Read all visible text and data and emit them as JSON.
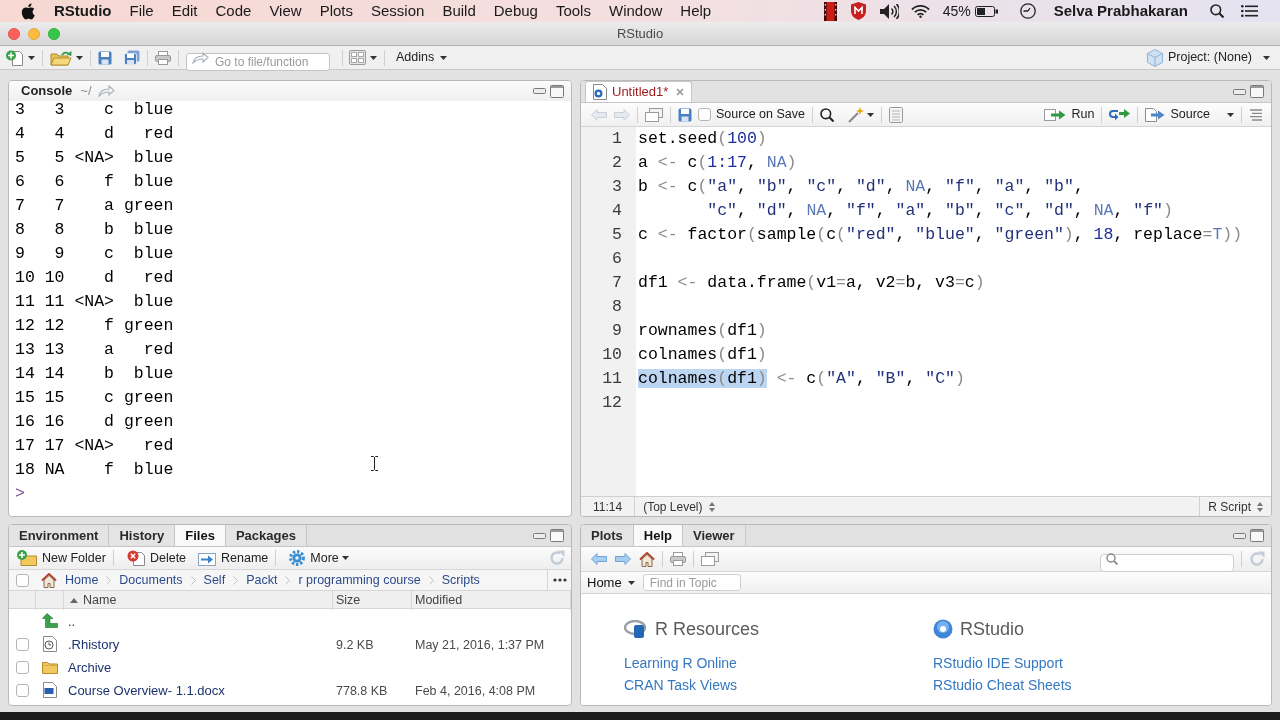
{
  "menu_bar": {
    "app_name": "RStudio",
    "menus": [
      "File",
      "Edit",
      "Code",
      "View",
      "Plots",
      "Session",
      "Build",
      "Debug",
      "Tools",
      "Window",
      "Help"
    ],
    "battery": "45%",
    "user": "Selva Prabhakaran"
  },
  "window": {
    "title": "RStudio"
  },
  "toolbar": {
    "go_to_placeholder": "Go to file/function",
    "addins": "Addins",
    "project": "Project: (None)"
  },
  "console": {
    "title": "Console",
    "directory": "~/",
    "lines": [
      "3   3    c  blue",
      "4   4    d   red",
      "5   5 <NA>  blue",
      "6   6    f  blue",
      "7   7    a green",
      "8   8    b  blue",
      "9   9    c  blue",
      "10 10    d   red",
      "11 11 <NA>  blue",
      "12 12    f green",
      "13 13    a   red",
      "14 14    b  blue",
      "15 15    c green",
      "16 16    d green",
      "17 17 <NA>   red",
      "18 NA    f  blue"
    ],
    "prompt": ">"
  },
  "editor": {
    "tabs": [
      {
        "label": "Untitled1*",
        "selected": true,
        "modified": true
      }
    ],
    "source_on_save": {
      "label": "Source on Save",
      "checked": false
    },
    "run": "Run",
    "source": "Source",
    "lines": [
      {
        "number": "1",
        "tokens": [
          {
            "kind": "plain",
            "text": "set.seed"
          },
          {
            "kind": "operator",
            "text": "("
          },
          {
            "kind": "number",
            "text": "100"
          },
          {
            "kind": "operator",
            "text": ")"
          }
        ]
      },
      {
        "number": "2",
        "tokens": [
          {
            "kind": "plain",
            "text": "a "
          },
          {
            "kind": "operator",
            "text": "<-"
          },
          {
            "kind": "plain",
            "text": " c"
          },
          {
            "kind": "operator",
            "text": "("
          },
          {
            "kind": "number",
            "text": "1:17"
          },
          {
            "kind": "plain",
            "text": ", "
          },
          {
            "kind": "constant",
            "text": "NA"
          },
          {
            "kind": "operator",
            "text": ")"
          }
        ]
      },
      {
        "number": "3",
        "tokens": [
          {
            "kind": "plain",
            "text": "b "
          },
          {
            "kind": "operator",
            "text": "<-"
          },
          {
            "kind": "plain",
            "text": " c"
          },
          {
            "kind": "operator",
            "text": "("
          },
          {
            "kind": "string",
            "text": "\"a\""
          },
          {
            "kind": "plain",
            "text": ", "
          },
          {
            "kind": "string",
            "text": "\"b\""
          },
          {
            "kind": "plain",
            "text": ", "
          },
          {
            "kind": "string",
            "text": "\"c\""
          },
          {
            "kind": "plain",
            "text": ", "
          },
          {
            "kind": "string",
            "text": "\"d\""
          },
          {
            "kind": "plain",
            "text": ", "
          },
          {
            "kind": "constant",
            "text": "NA"
          },
          {
            "kind": "plain",
            "text": ", "
          },
          {
            "kind": "string",
            "text": "\"f\""
          },
          {
            "kind": "plain",
            "text": ", "
          },
          {
            "kind": "string",
            "text": "\"a\""
          },
          {
            "kind": "plain",
            "text": ", "
          },
          {
            "kind": "string",
            "text": "\"b\""
          },
          {
            "kind": "plain",
            "text": ","
          }
        ]
      },
      {
        "number": "4",
        "tokens": [
          {
            "kind": "string",
            "text": "       \"c\""
          },
          {
            "kind": "plain",
            "text": ", "
          },
          {
            "kind": "string",
            "text": "\"d\""
          },
          {
            "kind": "plain",
            "text": ", "
          },
          {
            "kind": "constant",
            "text": "NA"
          },
          {
            "kind": "plain",
            "text": ", "
          },
          {
            "kind": "string",
            "text": "\"f\""
          },
          {
            "kind": "plain",
            "text": ", "
          },
          {
            "kind": "string",
            "text": "\"a\""
          },
          {
            "kind": "plain",
            "text": ", "
          },
          {
            "kind": "string",
            "text": "\"b\""
          },
          {
            "kind": "plain",
            "text": ", "
          },
          {
            "kind": "string",
            "text": "\"c\""
          },
          {
            "kind": "plain",
            "text": ", "
          },
          {
            "kind": "string",
            "text": "\"d\""
          },
          {
            "kind": "plain",
            "text": ", "
          },
          {
            "kind": "constant",
            "text": "NA"
          },
          {
            "kind": "plain",
            "text": ", "
          },
          {
            "kind": "string",
            "text": "\"f\""
          },
          {
            "kind": "operator",
            "text": ")"
          }
        ]
      },
      {
        "number": "5",
        "tokens": [
          {
            "kind": "plain",
            "text": "c "
          },
          {
            "kind": "operator",
            "text": "<-"
          },
          {
            "kind": "plain",
            "text": " factor"
          },
          {
            "kind": "operator",
            "text": "("
          },
          {
            "kind": "plain",
            "text": "sample"
          },
          {
            "kind": "operator",
            "text": "("
          },
          {
            "kind": "plain",
            "text": "c"
          },
          {
            "kind": "operator",
            "text": "("
          },
          {
            "kind": "string",
            "text": "\"red\""
          },
          {
            "kind": "plain",
            "text": ", "
          },
          {
            "kind": "string",
            "text": "\"blue\""
          },
          {
            "kind": "plain",
            "text": ", "
          },
          {
            "kind": "string",
            "text": "\"green\""
          },
          {
            "kind": "operator",
            "text": ")"
          },
          {
            "kind": "plain",
            "text": ", "
          },
          {
            "kind": "number",
            "text": "18"
          },
          {
            "kind": "plain",
            "text": ", replace"
          },
          {
            "kind": "operator",
            "text": "="
          },
          {
            "kind": "constant",
            "text": "T"
          },
          {
            "kind": "operator",
            "text": "))"
          }
        ]
      },
      {
        "number": "6"
      },
      {
        "number": "7",
        "tokens": [
          {
            "kind": "plain",
            "text": "df1 "
          },
          {
            "kind": "operator",
            "text": "<-"
          },
          {
            "kind": "plain",
            "text": " data.frame"
          },
          {
            "kind": "operator",
            "text": "("
          },
          {
            "kind": "plain",
            "text": "v1"
          },
          {
            "kind": "operator",
            "text": "="
          },
          {
            "kind": "plain",
            "text": "a, v2"
          },
          {
            "kind": "operator",
            "text": "="
          },
          {
            "kind": "plain",
            "text": "b, v3"
          },
          {
            "kind": "operator",
            "text": "="
          },
          {
            "kind": "plain",
            "text": "c"
          },
          {
            "kind": "operator",
            "text": ")"
          }
        ]
      },
      {
        "number": "8"
      },
      {
        "number": "9",
        "tokens": [
          {
            "kind": "plain",
            "text": "rownames"
          },
          {
            "kind": "operator",
            "text": "("
          },
          {
            "kind": "plain",
            "text": "df1"
          },
          {
            "kind": "operator",
            "text": ")"
          }
        ]
      },
      {
        "number": "10",
        "tokens": [
          {
            "kind": "plain",
            "text": "colnames"
          },
          {
            "kind": "operator",
            "text": "("
          },
          {
            "kind": "plain",
            "text": "df1"
          },
          {
            "kind": "operator",
            "text": ")"
          }
        ]
      },
      {
        "number": "11",
        "selection": [
          {
            "kind": "plain",
            "text": "colnames"
          },
          {
            "kind": "operator",
            "text": "("
          },
          {
            "kind": "plain",
            "text": "df1"
          },
          {
            "kind": "operator",
            "text": ")"
          }
        ],
        "tokens": [
          {
            "kind": "operator",
            "text": " <-"
          },
          {
            "kind": "plain",
            "text": " c"
          },
          {
            "kind": "operator",
            "text": "("
          },
          {
            "kind": "string",
            "text": "\"A\""
          },
          {
            "kind": "plain",
            "text": ", "
          },
          {
            "kind": "string",
            "text": "\"B\""
          },
          {
            "kind": "plain",
            "text": ", "
          },
          {
            "kind": "string",
            "text": "\"C\""
          },
          {
            "kind": "operator",
            "text": ")"
          }
        ]
      },
      {
        "number": "12"
      }
    ],
    "status": {
      "position": "11:14",
      "scope": "(Top Level)",
      "file_type": "R Script"
    }
  },
  "files_pane": {
    "tabs": [
      {
        "label": "Environment",
        "selected": false
      },
      {
        "label": "History",
        "selected": false
      },
      {
        "label": "Files",
        "selected": true
      },
      {
        "label": "Packages",
        "selected": false
      }
    ],
    "actions": [
      {
        "kind": "newfolder",
        "label": "New Folder"
      },
      {
        "kind": "delete",
        "label": "Delete"
      },
      {
        "kind": "rename",
        "label": "Rename"
      },
      {
        "kind": "more",
        "label": "More"
      }
    ],
    "select_all": {
      "checked": false
    },
    "breadcrumb": [
      "Home",
      "Documents",
      "Self",
      "Packt",
      "r programming course",
      "Scripts"
    ],
    "columns": [
      {
        "label": "Name",
        "sorted": true
      },
      {
        "label": "Size",
        "sorted": false
      },
      {
        "label": "Modified",
        "sorted": false
      }
    ],
    "rows": [
      {
        "kind": "parent",
        "name": ".."
      },
      {
        "kind": "history",
        "name": ".Rhistory",
        "size": "9.2 KB",
        "modified": "May 21, 2016, 1:37 PM",
        "checked": false
      },
      {
        "kind": "folder",
        "name": "Archive",
        "checked": false
      },
      {
        "kind": "document",
        "name": "Course Overview- 1.1.docx",
        "size": "778.8 KB",
        "modified": "Feb 4, 2016, 4:08 PM",
        "checked": false
      }
    ]
  },
  "help_pane": {
    "tabs": [
      {
        "label": "Plots",
        "selected": false
      },
      {
        "label": "Help",
        "selected": true
      },
      {
        "label": "Viewer",
        "selected": false
      }
    ],
    "topic": "Home",
    "find_placeholder": "Find in Topic",
    "sections": [
      {
        "kind": "r",
        "title": "R Resources",
        "links": [
          "Learning R Online",
          "CRAN Task Views"
        ]
      },
      {
        "kind": "rstudio",
        "title": "RStudio",
        "links": [
          "RStudio IDE Support",
          "RStudio Cheat Sheets"
        ]
      }
    ]
  }
}
